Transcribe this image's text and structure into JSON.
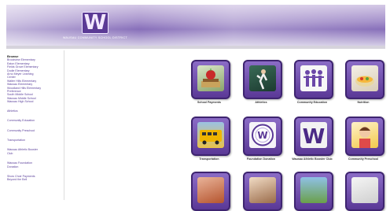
{
  "header": {
    "logo_letter": "W",
    "district_name": "WAUSAU COMMUNITY SCHOOL DISTRICT"
  },
  "sidebar": {
    "title": "Browse",
    "schools": [
      "Brookview Elementary",
      "Eaton Elementary",
      "Fields Grove Elementary",
      "Dodie Elementary",
      "Arno Meyer Learning",
      "Center",
      "Walter Hills Elementary",
      "Wausau Elementary",
      "Woodland Hills Elementary",
      "Preference",
      "South Middle School",
      "Wausau Middle School",
      "Wausau High School"
    ],
    "sections": [
      "Athletics",
      "Community Education",
      "Community Preschool",
      "Transportation",
      "Wausau Athletic Booster",
      "Club",
      "Wausau Foundation",
      "Donation",
      "Show Choir Payments",
      "Beyond the Bell"
    ]
  },
  "tiles": [
    {
      "label": "School Payments",
      "icon": "apple-books-icon"
    },
    {
      "label": "Athletics",
      "icon": "athlete-icon"
    },
    {
      "label": "Community Education",
      "icon": "people-icon"
    },
    {
      "label": "Nutrition",
      "icon": "bowl-icon"
    },
    {
      "label": "Transportation",
      "icon": "school-bus-icon"
    },
    {
      "label": "Foundation Donation",
      "icon": "w-seal-icon"
    },
    {
      "label": "Wausau Athletic Booster Club",
      "icon": "w-logo-icon"
    },
    {
      "label": "Community Preschool",
      "icon": "child-icon"
    },
    {
      "label": "",
      "icon": "students-icon"
    },
    {
      "label": "",
      "icon": "classroom-icon"
    },
    {
      "label": "",
      "icon": "graduation-icon"
    },
    {
      "label": "",
      "icon": "music-icon"
    }
  ]
}
